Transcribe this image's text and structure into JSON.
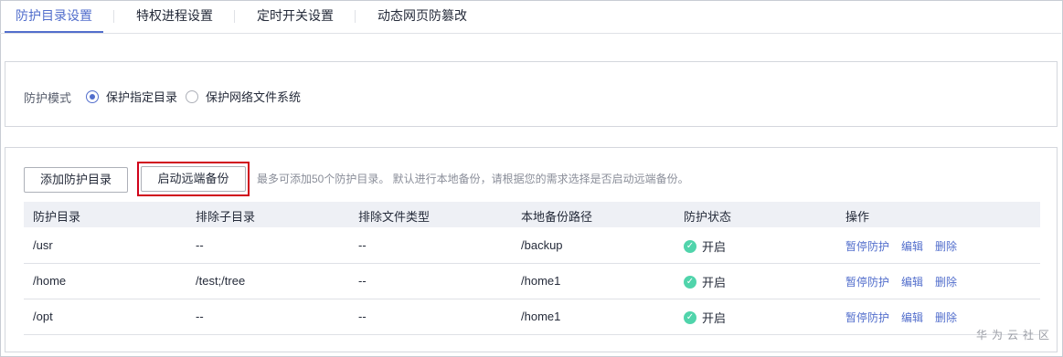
{
  "tabs": [
    {
      "label": "防护目录设置",
      "active": true
    },
    {
      "label": "特权进程设置",
      "active": false
    },
    {
      "label": "定时开关设置",
      "active": false
    },
    {
      "label": "动态网页防篡改",
      "active": false
    }
  ],
  "mode": {
    "label": "防护模式",
    "options": [
      {
        "label": "保护指定目录",
        "checked": true
      },
      {
        "label": "保护网络文件系统",
        "checked": false
      }
    ]
  },
  "toolbar": {
    "add_label": "添加防护目录",
    "remote_backup_label": "启动远端备份",
    "hint": "最多可添加50个防护目录。 默认进行本地备份，请根据您的需求选择是否启动远端备份。"
  },
  "table": {
    "columns": [
      "防护目录",
      "排除子目录",
      "排除文件类型",
      "本地备份路径",
      "防护状态",
      "操作"
    ],
    "rows": [
      {
        "dir": "/usr",
        "exclude_sub": "--",
        "exclude_type": "--",
        "backup_path": "/backup",
        "status": "开启"
      },
      {
        "dir": "/home",
        "exclude_sub": "/test;/tree",
        "exclude_type": "--",
        "backup_path": "/home1",
        "status": "开启"
      },
      {
        "dir": "/opt",
        "exclude_sub": "--",
        "exclude_type": "--",
        "backup_path": "/home1",
        "status": "开启"
      }
    ],
    "actions": {
      "pause": "暂停防护",
      "edit": "编辑",
      "delete": "删除"
    }
  },
  "status_icon": "check-circle-icon",
  "accent_color": "#526ecc",
  "watermark": "华为云社区"
}
